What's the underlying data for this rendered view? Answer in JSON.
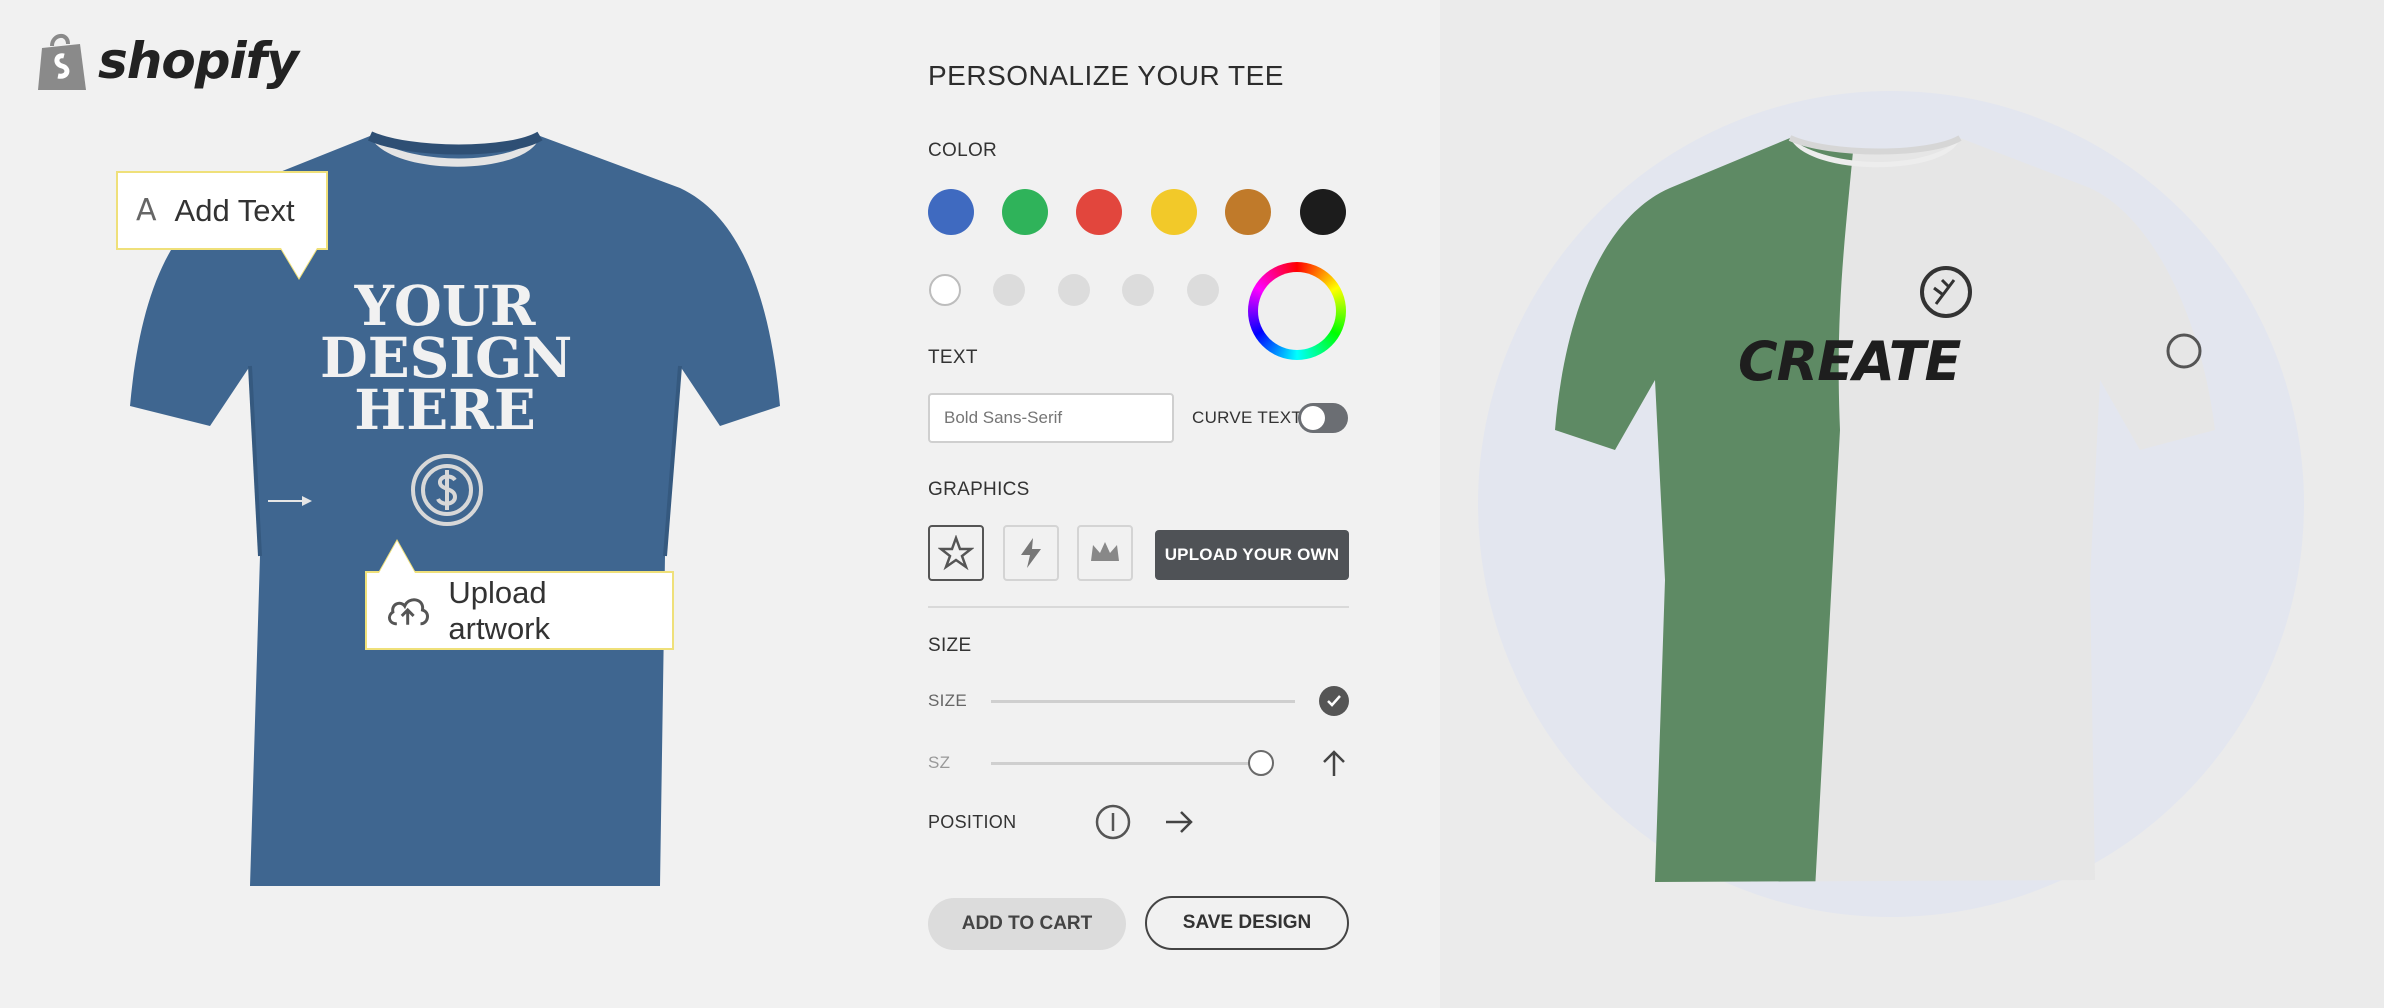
{
  "brand": {
    "name": "shopify"
  },
  "callouts": {
    "add_text": "Add Text",
    "upload_artwork": "Upload artwork"
  },
  "shirt_front": {
    "line1": "YOUR",
    "line2": "DESIGN",
    "line3": "HERE",
    "color": "#3f6690"
  },
  "config": {
    "title": "PERSONALIZE YOUR TEE",
    "color_label": "COLOR",
    "colors": [
      "#3f6ac0",
      "#2fb35a",
      "#e2463d",
      "#f2c929",
      "#c07a2a",
      "#1c1c1c"
    ],
    "text_label": "TEXT",
    "font_placeholder": "Bold Sans-Serif",
    "curve_text_label": "CURVE TEXT",
    "graphics_label": "GRAPHICS",
    "upload_own_label": "UPLOAD YOUR OWN",
    "size_section_label": "SIZE",
    "size_slider_label": "SIZE",
    "sz_slider_label": "SZ",
    "position_label": "POSITION",
    "add_to_cart_label": "ADD TO CART",
    "save_design_label": "SAVE DESIGN"
  },
  "shirt_preview": {
    "text": "CREATE",
    "left_color": "#5e8a64",
    "right_color": "#e6e6e6"
  }
}
